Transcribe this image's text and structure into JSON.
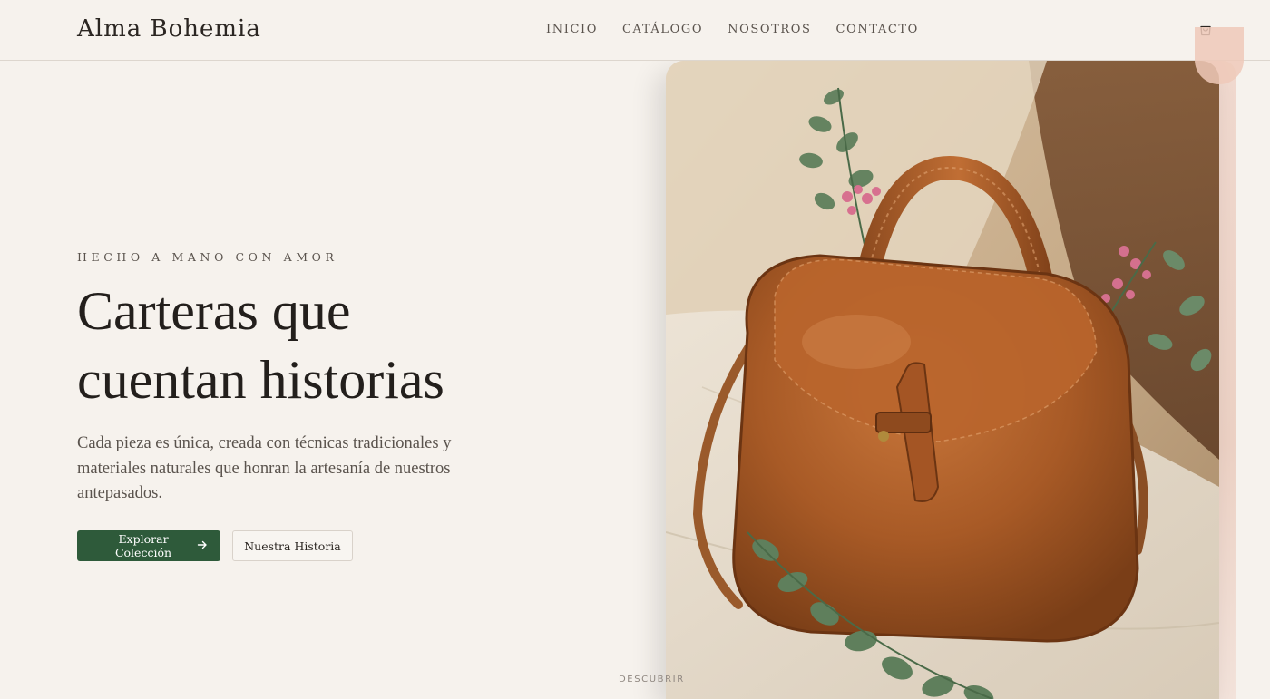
{
  "header": {
    "brand": "Alma Bohemia",
    "nav": [
      "INICIO",
      "CATÁLOGO",
      "NOSOTROS",
      "CONTACTO"
    ],
    "cart_icon": "shopping-bag-icon"
  },
  "hero": {
    "eyebrow": "HECHO A MANO CON AMOR",
    "headline_line1": "Carteras que",
    "headline_line2": "cuentan historias",
    "description": "Cada pieza es única, creada con técnicas tradicionales y materiales naturales que honran la artesanía de nuestros antepasados.",
    "primary_cta": "Explorar Colección",
    "primary_cta_icon": "arrow-right-icon",
    "secondary_cta": "Nuestra Historia",
    "scroll_hint": "DESCUBRIR"
  },
  "colors": {
    "background": "#f6f2ed",
    "primary": "#2e5a3a",
    "text": "#2b2622",
    "muted": "#5a534d",
    "accent": "#efc9b8"
  }
}
